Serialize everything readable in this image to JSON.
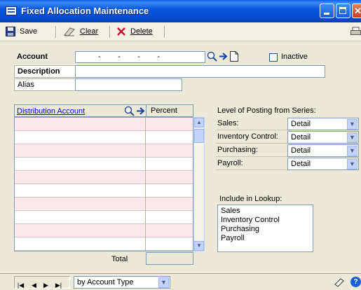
{
  "window": {
    "title": "Fixed Allocation Maintenance"
  },
  "toolbar": {
    "save": "Save",
    "clear": "Clear",
    "delete": "Delete"
  },
  "form": {
    "account_label": "Account",
    "account_mask": "-        -        -        -",
    "inactive_label": "Inactive",
    "description_label": "Description",
    "alias_label": "Alias"
  },
  "grid": {
    "distribution_account": "Distribution Account",
    "percent": "Percent",
    "total": "Total",
    "row_count": 10
  },
  "posting": {
    "title": "Level of Posting from Series:",
    "rows": [
      {
        "label": "Sales:",
        "value": "Detail"
      },
      {
        "label": "Inventory Control:",
        "value": "Detail"
      },
      {
        "label": "Purchasing:",
        "value": "Detail"
      },
      {
        "label": "Payroll:",
        "value": "Detail"
      }
    ]
  },
  "lookup": {
    "title": "Include in Lookup:",
    "items": [
      "Sales",
      "Inventory Control",
      "Purchasing",
      "Payroll"
    ]
  },
  "status": {
    "sort_value": "by Account Type"
  }
}
